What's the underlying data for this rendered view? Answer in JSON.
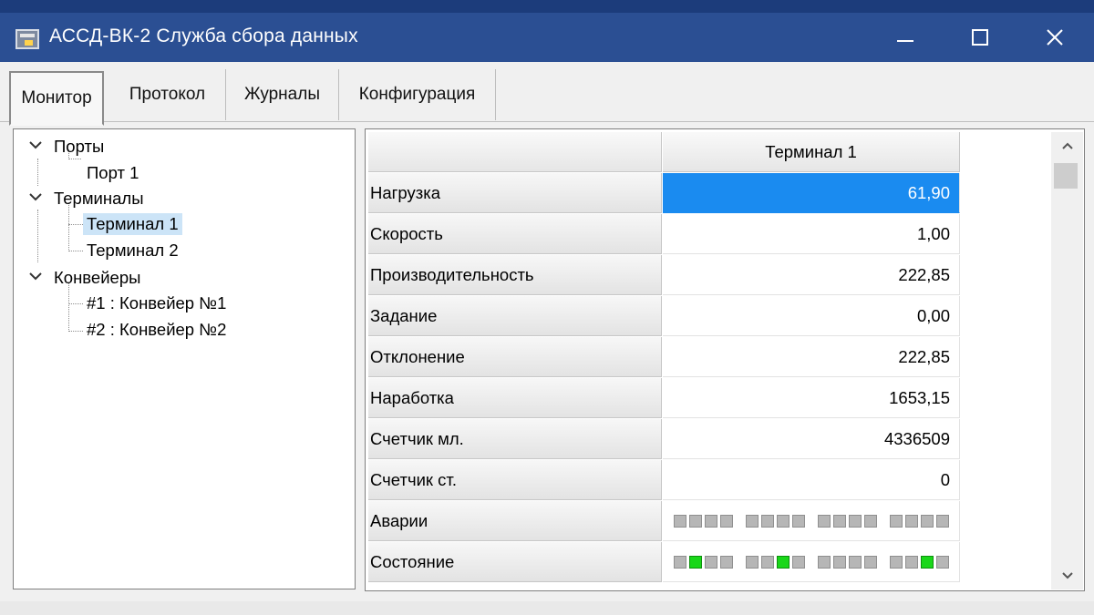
{
  "window": {
    "title": "АССД-ВК-2 Служба сбора данных",
    "titlebar_color": "#2b4f93"
  },
  "tabs": [
    {
      "label": "Монитор",
      "active": true
    },
    {
      "label": "Протокол",
      "active": false
    },
    {
      "label": "Журналы",
      "active": false
    },
    {
      "label": "Конфигурация",
      "active": false
    }
  ],
  "tree": {
    "groups": [
      {
        "label": "Порты",
        "expanded": true,
        "children": [
          "Порт 1"
        ]
      },
      {
        "label": "Терминалы",
        "expanded": true,
        "children": [
          "Терминал 1",
          "Терминал 2"
        ],
        "selected_child": "Терминал 1"
      },
      {
        "label": "Конвейеры",
        "expanded": true,
        "children": [
          "#1 : Конвейер №1",
          "#2 : Конвейер №2"
        ]
      }
    ]
  },
  "grid": {
    "column_header": "Терминал 1",
    "rows": [
      {
        "label": "Нагрузка",
        "value": "61,90",
        "selected": true
      },
      {
        "label": "Скорость",
        "value": "1,00"
      },
      {
        "label": "Производительность",
        "value": "222,85"
      },
      {
        "label": "Задание",
        "value": "0,00"
      },
      {
        "label": "Отклонение",
        "value": "222,85"
      },
      {
        "label": "Наработка",
        "value": "1653,15"
      },
      {
        "label": "Счетчик мл.",
        "value": "4336509"
      },
      {
        "label": "Счетчик ст.",
        "value": "0"
      },
      {
        "label": "Аварии",
        "indicators": [
          [
            0,
            0,
            0,
            0
          ],
          [
            0,
            0,
            0,
            0
          ],
          [
            0,
            0,
            0,
            0
          ],
          [
            0,
            0,
            0,
            0
          ]
        ]
      },
      {
        "label": "Состояние",
        "indicators": [
          [
            0,
            1,
            0,
            0
          ],
          [
            0,
            0,
            1,
            0
          ],
          [
            0,
            0,
            0,
            0
          ],
          [
            0,
            0,
            1,
            0
          ]
        ]
      }
    ],
    "selection_color": "#1a8bf0",
    "indicator_on_color": "#19d719",
    "indicator_off_color": "#b6b6b6"
  },
  "icons": {
    "app": "app-window-icon",
    "minimize": "minimize-icon",
    "maximize": "maximize-icon",
    "close": "close-icon",
    "expand": "chevron-down-icon",
    "scroll_up": "scroll-up-arrow-icon",
    "scroll_down": "scroll-down-arrow-icon"
  }
}
